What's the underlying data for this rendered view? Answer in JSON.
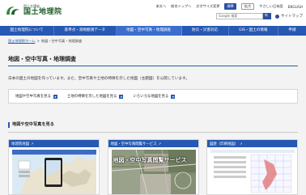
{
  "header": {
    "logo_small": "国土交通省",
    "logo_big": "国土地理院",
    "utils": [
      {
        "label": "本文へ",
        "style": "plain"
      },
      {
        "label": "総合トップへ",
        "style": "plain"
      },
      {
        "label": "文字サイズ変更",
        "style": "plain"
      },
      {
        "label": "標準",
        "style": "active"
      },
      {
        "label": "拡大",
        "style": "outline"
      },
      {
        "label": "やさしい日本語",
        "style": "plain"
      },
      {
        "label": "ENGLISH",
        "style": "plain"
      }
    ],
    "search_placeholder": "Google 検索",
    "search_button": "🔍",
    "sitemap": "サイトマップ"
  },
  "nav": {
    "items": [
      "国土地理院について",
      "基準点・測地観測データ",
      "地図・空中写真・地理調査",
      "防災・災害対応",
      "GIS・国土の情報",
      "申請"
    ],
    "current_index": 2
  },
  "breadcrumb": {
    "home": "国土地理院ホーム",
    "sep": ">",
    "current": "地図・空中写真・地理調査"
  },
  "page": {
    "title": "地図・空中写真・地理調査",
    "lead": "日本の国土の地図を作っています。また、空中写真や土地の特徴を示した地図（主題図）を公開しています。"
  },
  "quick_links": [
    "地図や空中写真を見る",
    "土地の特徴を示した地図を見る",
    "いろいろな地図を見る"
  ],
  "section": {
    "title": "地図や空中写真を見る"
  },
  "cards": [
    {
      "title": "地理院地図",
      "overlay": ""
    },
    {
      "title": "地図・空中写真閲覧サービス",
      "overlay": "地図・空中写真閲覧サービス"
    },
    {
      "title": "図歴（印刷地図）",
      "overlay": ""
    }
  ],
  "colors": {
    "nav_blue": "#2659b3",
    "logo_green": "#1f5e2a",
    "page_bg": "#f3f3f3"
  }
}
